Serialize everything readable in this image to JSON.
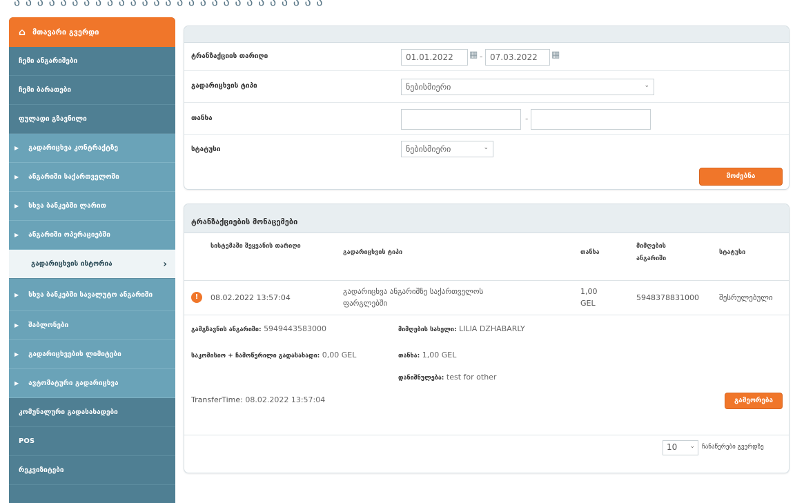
{
  "topstrip": "ა ა ა ა ა ა ა ა ა ა ა ა ა ა ა ა ა ა ა ა ა ა ა ა ა ა ა",
  "sidebar": {
    "home": {
      "icon": "home-icon",
      "label": "მთავარი გვერდი"
    },
    "items": [
      {
        "label": "ჩემი ანგარიშები",
        "type": "dark"
      },
      {
        "label": "ჩემი ბარათები",
        "type": "dark"
      },
      {
        "label": "ფულადი გზავნილი",
        "type": "dark"
      },
      {
        "label": "გადარიცხვა კონტრაქტზე",
        "type": "sub"
      },
      {
        "label": "ანგარიში საქართველოში",
        "type": "sub"
      },
      {
        "label": "სხვა ბანკებში ლარით",
        "type": "sub"
      },
      {
        "label": "ანგარიში ოპერაციებში",
        "type": "sub"
      },
      {
        "label": "გადარიცხვის ისტორია",
        "type": "active"
      },
      {
        "label": "სხვა ბანკებში სავალუტო ანგარიში",
        "type": "sub-tall"
      },
      {
        "label": "შაბლონები",
        "type": "sub"
      },
      {
        "label": "გადარიცხვების ლიმიტები",
        "type": "sub"
      },
      {
        "label": "ავტომატური გადარიცხვა",
        "type": "sub"
      },
      {
        "label": "კომუნალური გადასახადები",
        "type": "dark"
      },
      {
        "label": "POS",
        "type": "dark"
      },
      {
        "label": "რეკვიზიტები",
        "type": "dark"
      }
    ]
  },
  "filter": {
    "date_label": "ტრანზაქციის თარიღი",
    "date_from": "01.01.2022",
    "date_to": "07.03.2022",
    "type_label": "გადარიცხვის ტიპი",
    "type_value": "ნებისმიერი",
    "amount_label": "თანხა",
    "amount_from": "",
    "amount_to": "",
    "status_label": "სტატუსი",
    "status_value": "ნებისმიერი",
    "search_button": "მოძებნა"
  },
  "results": {
    "title": "ტრანზაქციების მონაცემები",
    "columns": [
      "სისტემაში შეყვანის თარიღი",
      "გადარიცხვის ტიპი",
      "თანხა",
      "მიმღების ანგარიში",
      "სტატუსი"
    ],
    "row": {
      "status_icon": "exclamation-icon",
      "date": "08.02.2022 13:57:04",
      "type": "გადარიცხვა ანგარიშზე საქართველოს ფარგლებში",
      "amount": "1,00 GEL",
      "receiver_account": "5948378831000",
      "status": "შესრულებული"
    },
    "details": {
      "sender_label": "გამგზავნის ანგარიში:",
      "sender_value": "5949443583000",
      "receiver_name_label": "მიმღების სახელი:",
      "receiver_name_value": "LILIA DZHABARLY",
      "amount_fee_label": "საკომისიო + ჩამოწერილი გადასახადი:",
      "amount_fee_value": "0,00 GEL",
      "amount_label": "თანხა:",
      "amount_value": "1,00 GEL",
      "purpose_label": "დანიშნულება:",
      "purpose_value": "test for other",
      "transfer_time_label": "TransferTime:",
      "transfer_time_value": "08.02.2022 13:57:04",
      "repeat_button": "გამეორება"
    },
    "page_size": "10",
    "page_size_label": "ჩანაწერები გვერდზე"
  }
}
